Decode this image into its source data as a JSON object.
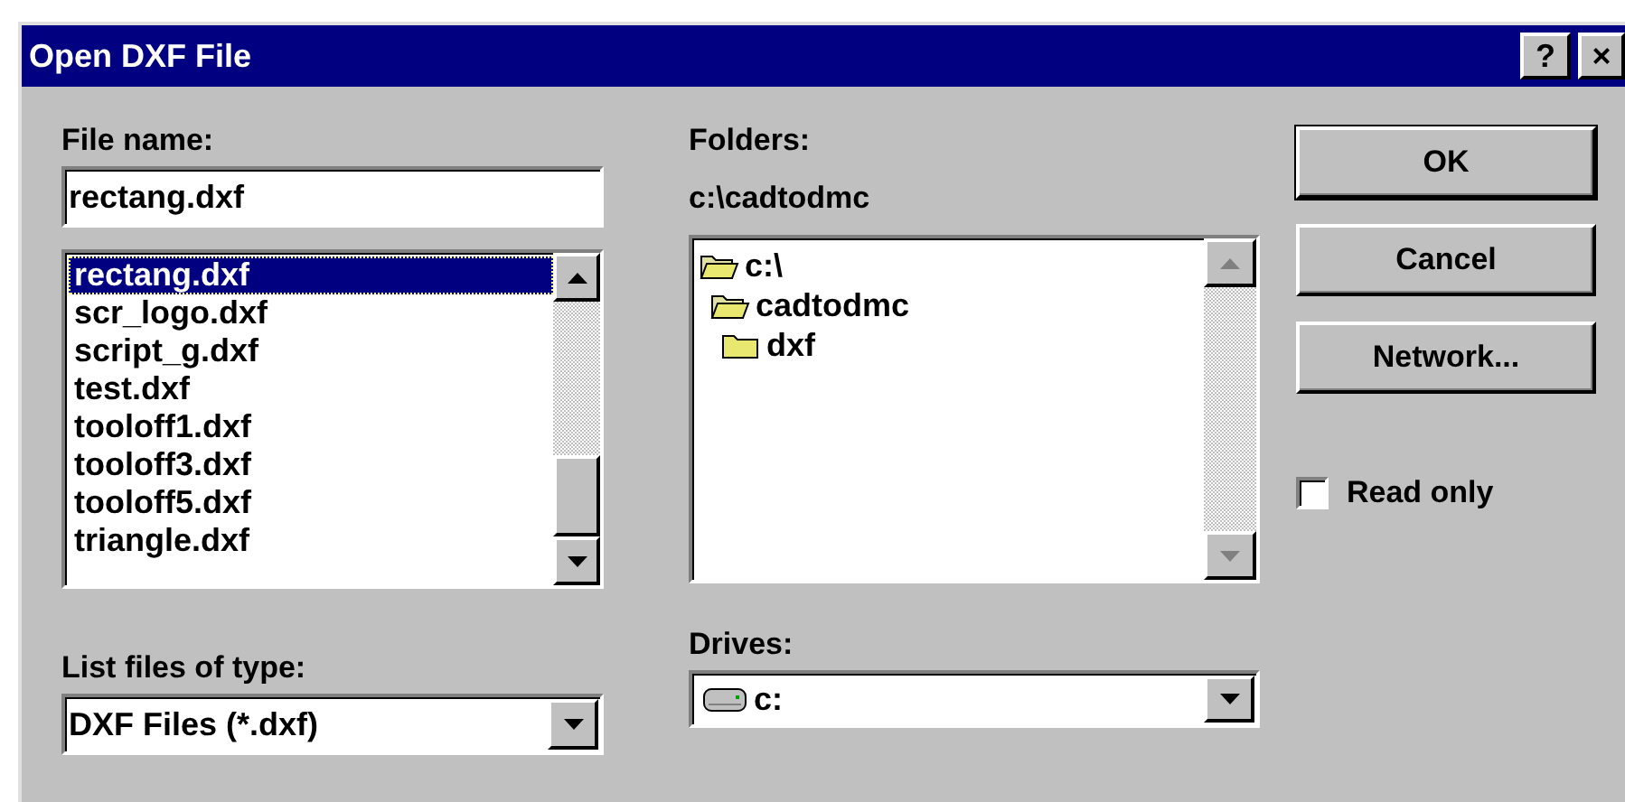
{
  "window": {
    "title": "Open DXF File",
    "controls": [
      {
        "kind": "help",
        "label": "?"
      },
      {
        "kind": "close",
        "label": "×"
      }
    ]
  },
  "file_name": {
    "label": "File name:",
    "value": "rectang.dxf"
  },
  "files": [
    {
      "name": "rectang.dxf",
      "selected": true
    },
    {
      "name": "scr_logo.dxf",
      "selected": false
    },
    {
      "name": "script_g.dxf",
      "selected": false
    },
    {
      "name": "test.dxf",
      "selected": false
    },
    {
      "name": "tooloff1.dxf",
      "selected": false
    },
    {
      "name": "tooloff3.dxf",
      "selected": false
    },
    {
      "name": "tooloff5.dxf",
      "selected": false
    },
    {
      "name": "triangle.dxf",
      "selected": false
    }
  ],
  "file_type": {
    "label": "List files of type:",
    "value": "DXF Files (*.dxf)"
  },
  "folders": {
    "label": "Folders:",
    "path": "c:\\cadtodmc",
    "items": [
      {
        "name": "c:\\",
        "kind": "open",
        "children": [
          {
            "name": "cadtodmc",
            "kind": "open",
            "children": [
              {
                "name": "dxf",
                "kind": "closed"
              }
            ]
          }
        ]
      }
    ]
  },
  "drives": {
    "label": "Drives:",
    "value": "c:"
  },
  "buttons": [
    {
      "label": "OK",
      "default": true
    },
    {
      "label": "Cancel",
      "default": false
    },
    {
      "label": "Network...",
      "default": false
    }
  ],
  "read_only": {
    "label": "Read only",
    "checked": false
  }
}
